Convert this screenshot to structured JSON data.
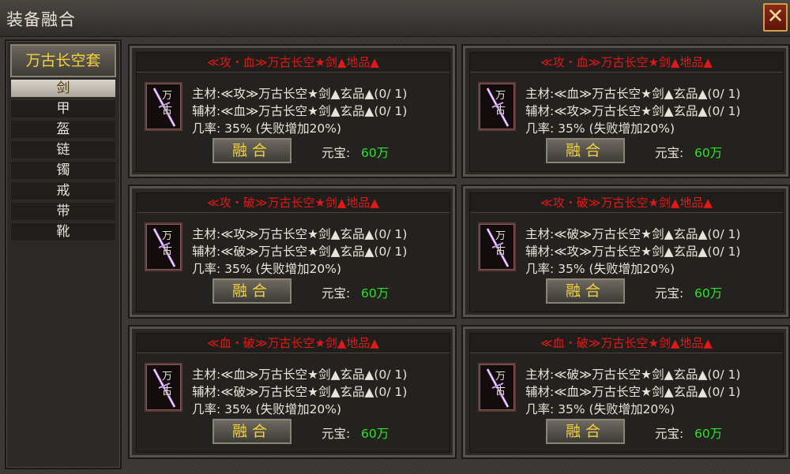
{
  "window": {
    "title": "装备融合",
    "close_label": "✕"
  },
  "sidebar": {
    "set_label": "万古长空套",
    "categories": [
      "剑",
      "甲",
      "盔",
      "链",
      "镯",
      "戒",
      "带",
      "靴"
    ],
    "active_index": 0
  },
  "cards": [
    {
      "title": "≪攻・血≫万古长空★剑▲地品▲",
      "item_label": "万古",
      "main_material": "主材:≪攻≫万古长空★剑▲玄品▲(0/ 1)",
      "sub_material": "辅材:≪血≫万古长空★剑▲玄品▲(0/ 1)",
      "rate": "几率:  35% (失败增加20%)",
      "button_label": "融合",
      "price_label": "元宝:",
      "price_value": "60万"
    },
    {
      "title": "≪攻・血≫万古长空★剑▲地品▲",
      "item_label": "万古",
      "main_material": "主材:≪血≫万古长空★剑▲玄品▲(0/ 1)",
      "sub_material": "辅材:≪攻≫万古长空★剑▲玄品▲(0/ 1)",
      "rate": "几率:  35% (失败增加20%)",
      "button_label": "融合",
      "price_label": "元宝:",
      "price_value": "60万"
    },
    {
      "title": "≪攻・破≫万古长空★剑▲地品▲",
      "item_label": "万古",
      "main_material": "主材:≪攻≫万古长空★剑▲玄品▲(0/ 1)",
      "sub_material": "辅材:≪破≫万古长空★剑▲玄品▲(0/ 1)",
      "rate": "几率:  35% (失败增加20%)",
      "button_label": "融合",
      "price_label": "元宝:",
      "price_value": "60万"
    },
    {
      "title": "≪攻・破≫万古长空★剑▲地品▲",
      "item_label": "万古",
      "main_material": "主材:≪破≫万古长空★剑▲玄品▲(0/ 1)",
      "sub_material": "辅材:≪攻≫万古长空★剑▲玄品▲(0/ 1)",
      "rate": "几率:  35% (失败增加20%)",
      "button_label": "融合",
      "price_label": "元宝:",
      "price_value": "60万"
    },
    {
      "title": "≪血・破≫万古长空★剑▲地品▲",
      "item_label": "万古",
      "main_material": "主材:≪血≫万古长空★剑▲玄品▲(0/ 1)",
      "sub_material": "辅材:≪破≫万古长空★剑▲玄品▲(0/ 1)",
      "rate": "几率:  35% (失败增加20%)",
      "button_label": "融合",
      "price_label": "元宝:",
      "price_value": "60万"
    },
    {
      "title": "≪血・破≫万古长空★剑▲地品▲",
      "item_label": "万古",
      "main_material": "主材:≪破≫万古长空★剑▲玄品▲(0/ 1)",
      "sub_material": "辅材:≪血≫万古长空★剑▲玄品▲(0/ 1)",
      "rate": "几率:  35% (失败增加20%)",
      "button_label": "融合",
      "price_label": "元宝:",
      "price_value": "60万"
    }
  ],
  "colors": {
    "title_red": "#e01818",
    "price_green": "#2fe02f",
    "button_gold": "#f4d23a"
  }
}
